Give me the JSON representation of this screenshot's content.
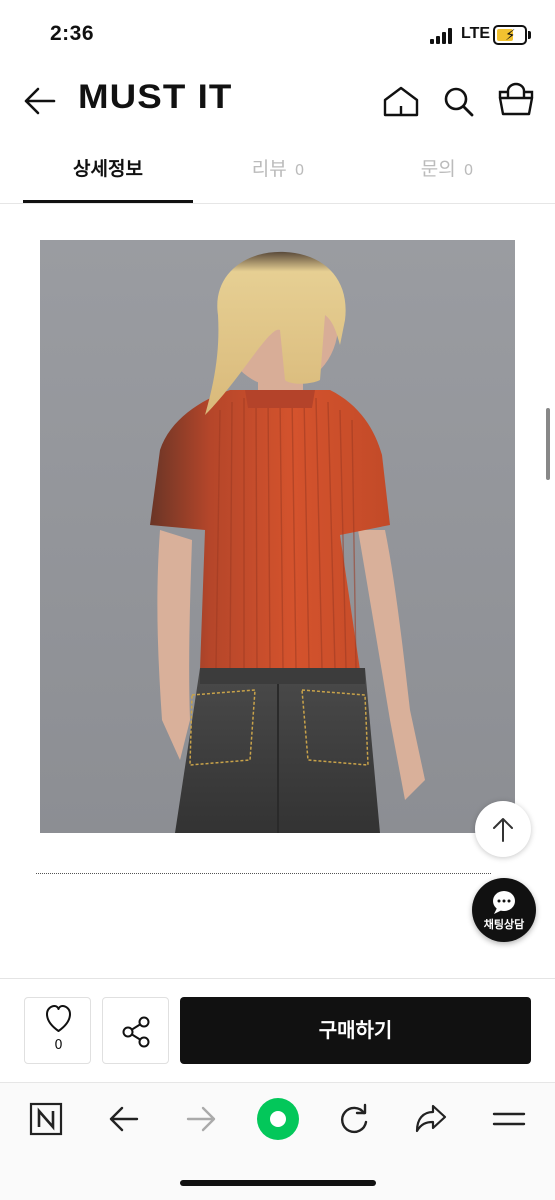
{
  "status_bar": {
    "time": "2:36",
    "network": "LTE",
    "battery_color": "#f2c230"
  },
  "header": {
    "logo": "MUST IT",
    "icons": [
      "back-arrow-icon",
      "home-icon",
      "search-icon",
      "shopping-bag-icon"
    ]
  },
  "tabs": [
    {
      "label": "상세정보",
      "count": "",
      "active": true
    },
    {
      "label": "리뷰",
      "count": "0",
      "active": false
    },
    {
      "label": "문의",
      "count": "0",
      "active": false
    }
  ],
  "product_image": {
    "subject": "product photo",
    "colors": {
      "background": "#94969b",
      "top": "#c44a28",
      "jeans": "#3d3d3d",
      "hair": "#e3c98b"
    }
  },
  "floating": {
    "scroll_top_icon": "arrow-up-icon",
    "chat_label": "채팅상담"
  },
  "purchase_bar": {
    "like_count": "0",
    "buy_label": "구매하기"
  },
  "browser_toolbar": {
    "items": [
      "naver-icon",
      "back-icon",
      "forward-icon",
      "green-circle-icon",
      "refresh-icon",
      "share-icon",
      "menu-icon"
    ],
    "accent": "#03c75a"
  }
}
